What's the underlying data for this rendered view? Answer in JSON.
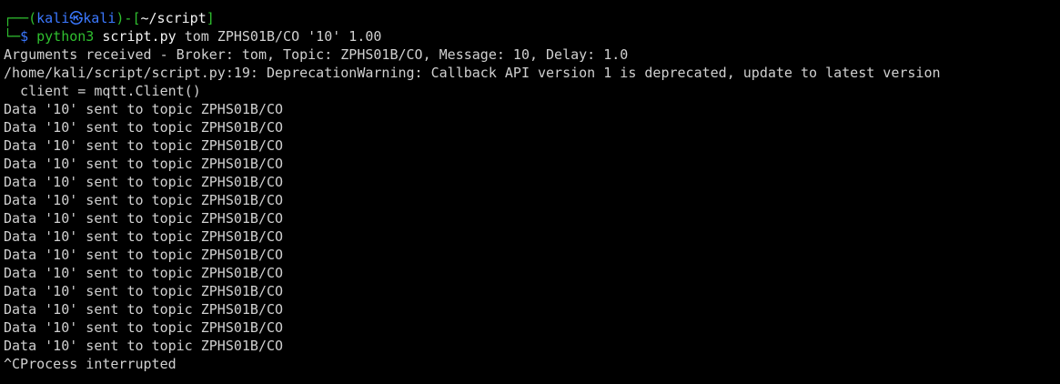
{
  "prompt": {
    "box_top": "┌──(",
    "user": "kali",
    "at_icon": "㉿",
    "host": "kali",
    "close_host": ")-[",
    "path": "~/script",
    "close_path": "]",
    "box_bottom": "└─",
    "symbol": "$ "
  },
  "command": {
    "program": "python3",
    "script": "script.py",
    "args": "tom ZPHS01B/CO '10' 1.00"
  },
  "output": {
    "args_line": "Arguments received - Broker: tom, Topic: ZPHS01B/CO, Message: 10, Delay: 1.0",
    "warning_line": "/home/kali/script/script.py:19: DeprecationWarning: Callback API version 1 is deprecated, update to latest version",
    "client_line": "  client = mqtt.Client()",
    "data_lines": [
      "Data '10' sent to topic ZPHS01B/CO",
      "Data '10' sent to topic ZPHS01B/CO",
      "Data '10' sent to topic ZPHS01B/CO",
      "Data '10' sent to topic ZPHS01B/CO",
      "Data '10' sent to topic ZPHS01B/CO",
      "Data '10' sent to topic ZPHS01B/CO",
      "Data '10' sent to topic ZPHS01B/CO",
      "Data '10' sent to topic ZPHS01B/CO",
      "Data '10' sent to topic ZPHS01B/CO",
      "Data '10' sent to topic ZPHS01B/CO",
      "Data '10' sent to topic ZPHS01B/CO",
      "Data '10' sent to topic ZPHS01B/CO",
      "Data '10' sent to topic ZPHS01B/CO",
      "Data '10' sent to topic ZPHS01B/CO"
    ],
    "interrupt_line": "^CProcess interrupted"
  },
  "colors": {
    "background": "#000000",
    "prompt_green": "#2fbf2f",
    "prompt_blue": "#3b78ff",
    "text": "#d0d0d0"
  }
}
